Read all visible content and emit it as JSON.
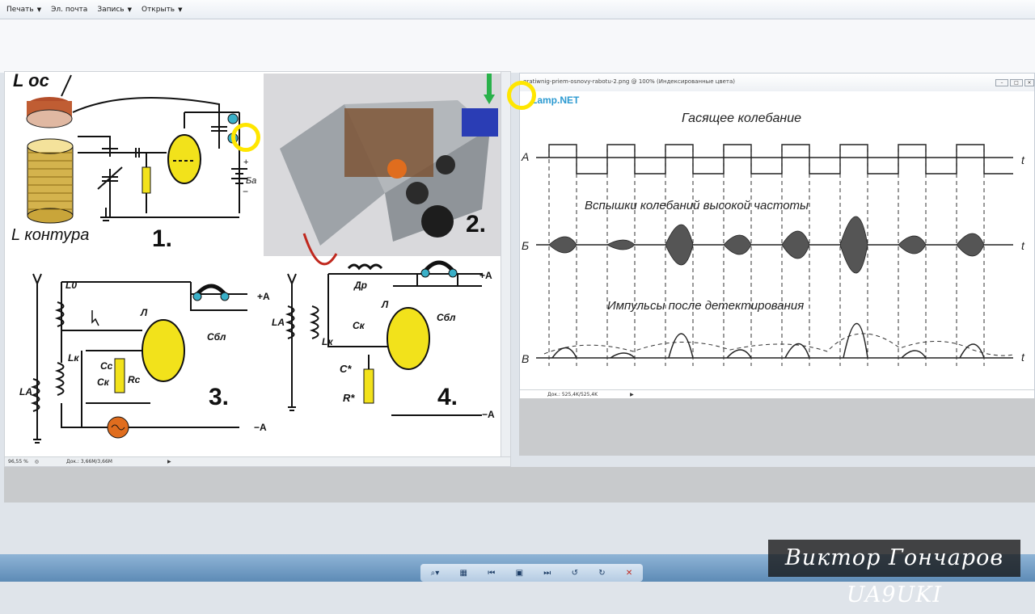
{
  "menu": {
    "items": [
      {
        "label": "Печать"
      },
      {
        "label": "Эл. почта"
      },
      {
        "label": "Запись"
      },
      {
        "label": "Открыть"
      }
    ]
  },
  "left_viewer": {
    "zoom": "96,55 %",
    "doc_info": "Док.: 3,66M/3,66M",
    "figure": {
      "l_os": "L ос",
      "l_kontura": "L контура",
      "ba": "Ба",
      "plus": "+",
      "minus": "−",
      "num1": "1.",
      "num2": "2.",
      "num3": "3.",
      "num4": "4.",
      "l0": "L0",
      "la": "LA",
      "lk": "Lк",
      "cc": "Cc",
      "ck": "Cк",
      "rc": "Rc",
      "l": "Л",
      "cbl": "Cбл",
      "plus_a": "+A",
      "minus_a": "−A",
      "dr": "Др",
      "c_star": "C*",
      "r_star": "R*"
    }
  },
  "right_viewer": {
    "title": "gratiwnig-priem-osnovy-rabotu-2.png @ 100% (Индексированные цвета)",
    "logo": "Lamp.NET",
    "doc_info": "Док.: 525,4K/525,4K",
    "graph": {
      "title": "Гасящее колебание",
      "label_bursts": "Вспышки колебаний высокой частоты",
      "label_pulses": "Импульсы после детектирования",
      "row_a": "А",
      "row_b": "Б",
      "row_v": "В",
      "t": "t"
    }
  },
  "taskbar": {
    "buttons": [
      "zoom-icon",
      "fit-icon",
      "prev-icon",
      "slideshow-icon",
      "next-icon",
      "rotate-left-icon",
      "rotate-right-icon",
      "delete-icon"
    ]
  },
  "signature": "Виктор Гончаров UA9UKI"
}
